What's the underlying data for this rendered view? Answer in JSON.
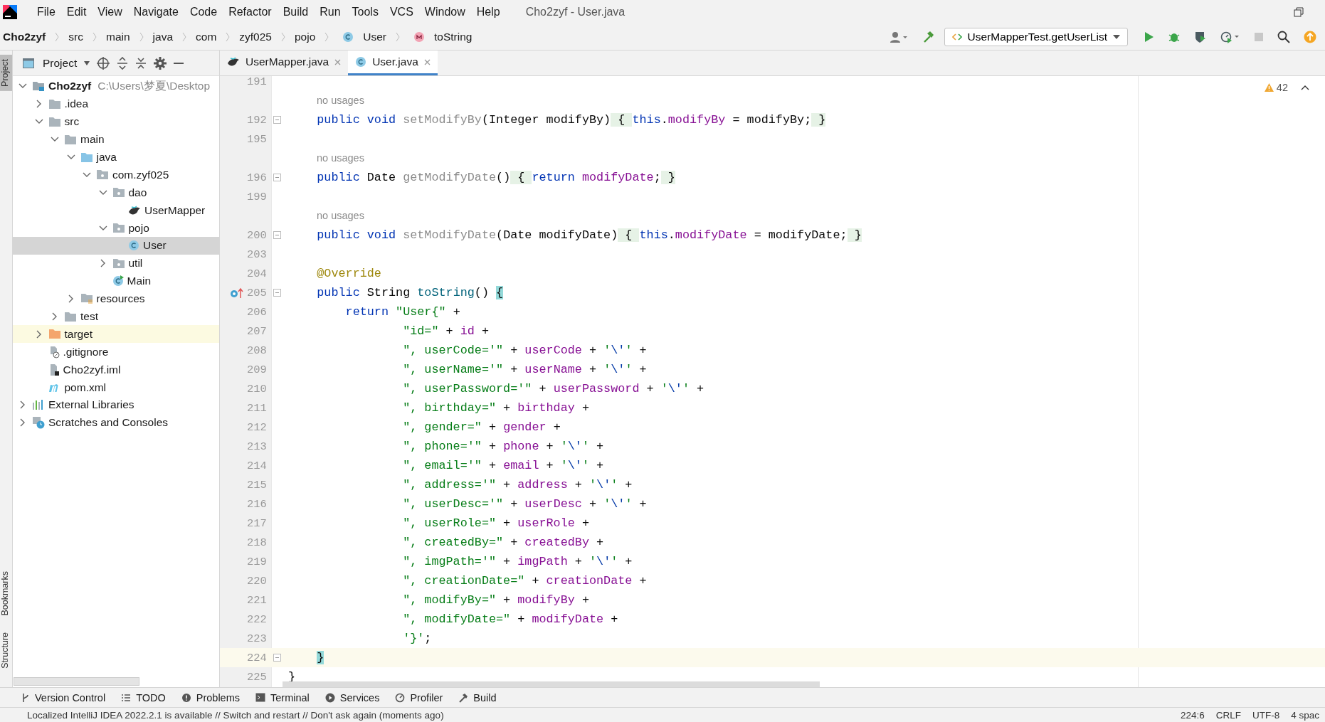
{
  "window": {
    "title": "Cho2zyf - User.java"
  },
  "menu": [
    "File",
    "Edit",
    "View",
    "Navigate",
    "Code",
    "Refactor",
    "Build",
    "Run",
    "Tools",
    "VCS",
    "Window",
    "Help"
  ],
  "breadcrumbs": [
    {
      "label": "Cho2zyf",
      "kind": "project"
    },
    {
      "label": "src",
      "kind": "folder"
    },
    {
      "label": "main",
      "kind": "folder"
    },
    {
      "label": "java",
      "kind": "folder"
    },
    {
      "label": "com",
      "kind": "folder"
    },
    {
      "label": "zyf025",
      "kind": "folder"
    },
    {
      "label": "pojo",
      "kind": "folder"
    },
    {
      "label": "User",
      "kind": "class"
    },
    {
      "label": "toString",
      "kind": "method"
    }
  ],
  "run_config": "UserMapperTest.getUserList",
  "side_strip": [
    {
      "label": "Project",
      "selected": true
    },
    {
      "label": "Bookmarks",
      "selected": false
    },
    {
      "label": "Structure",
      "selected": false
    }
  ],
  "project": {
    "title": "Project",
    "tree": [
      {
        "label": "Cho2zyf",
        "path": "C:\\Users\\梦夏\\Desktop",
        "kind": "module",
        "expanded": true,
        "selected": false,
        "highlighted": false,
        "children": [
          {
            "label": ".idea",
            "kind": "folder",
            "expanded": false,
            "selected": false,
            "highlighted": false
          },
          {
            "label": "src",
            "kind": "folder",
            "expanded": true,
            "selected": false,
            "highlighted": false,
            "children": [
              {
                "label": "main",
                "kind": "folder",
                "expanded": true,
                "selected": false,
                "highlighted": false,
                "children": [
                  {
                    "label": "java",
                    "kind": "source",
                    "expanded": true,
                    "selected": false,
                    "highlighted": false,
                    "children": [
                      {
                        "label": "com.zyf025",
                        "kind": "package",
                        "expanded": true,
                        "selected": false,
                        "highlighted": false,
                        "children": [
                          {
                            "label": "dao",
                            "kind": "package",
                            "expanded": true,
                            "selected": false,
                            "highlighted": false,
                            "children": [
                              {
                                "label": "UserMapper",
                                "kind": "mapper",
                                "selected": false,
                                "highlighted": false
                              }
                            ]
                          },
                          {
                            "label": "pojo",
                            "kind": "package",
                            "expanded": true,
                            "selected": false,
                            "highlighted": false,
                            "children": [
                              {
                                "label": "User",
                                "kind": "class",
                                "selected": true,
                                "highlighted": false
                              }
                            ]
                          },
                          {
                            "label": "util",
                            "kind": "package",
                            "expanded": false,
                            "selected": false,
                            "highlighted": false
                          },
                          {
                            "label": "Main",
                            "kind": "main",
                            "selected": false,
                            "highlighted": false
                          }
                        ]
                      }
                    ]
                  },
                  {
                    "label": "resources",
                    "kind": "resources",
                    "expanded": false,
                    "selected": false,
                    "highlighted": false
                  }
                ]
              },
              {
                "label": "test",
                "kind": "folder",
                "expanded": false,
                "selected": false,
                "highlighted": false
              }
            ]
          },
          {
            "label": "target",
            "kind": "excluded",
            "expanded": false,
            "selected": false,
            "highlighted": true
          },
          {
            "label": ".gitignore",
            "kind": "ignore",
            "selected": false,
            "highlighted": false
          },
          {
            "label": "Cho2zyf.iml",
            "kind": "iml",
            "selected": false,
            "highlighted": false
          },
          {
            "label": "pom.xml",
            "kind": "maven",
            "selected": false,
            "highlighted": false
          }
        ]
      },
      {
        "label": "External Libraries",
        "kind": "libraries",
        "expanded": false,
        "selected": false,
        "highlighted": false
      },
      {
        "label": "Scratches and Consoles",
        "kind": "scratches",
        "expanded": false,
        "selected": false,
        "highlighted": false
      }
    ]
  },
  "tabs": [
    {
      "label": "UserMapper.java",
      "kind": "mapper",
      "selected": false
    },
    {
      "label": "User.java",
      "kind": "class",
      "selected": true
    }
  ],
  "editor": {
    "warnings": "42",
    "rows": [
      {
        "kind": "code",
        "number": "191"
      },
      {
        "kind": "hint",
        "text": "no usages"
      },
      {
        "kind": "code",
        "number": "192",
        "fold_marker": true,
        "tokens": [
          {
            "text": "    public void ",
            "kind": "kw"
          },
          {
            "text": "setModifyBy",
            "kind": "unused"
          },
          {
            "text": "(Integer modifyBy)",
            "kind": "plain"
          },
          {
            "text": " { ",
            "kind": "fold"
          },
          {
            "text": "this",
            "kind": "kw"
          },
          {
            "text": ".",
            "kind": "plain"
          },
          {
            "text": "modifyBy",
            "kind": "field"
          },
          {
            "text": " = modifyBy;",
            "kind": "plain"
          },
          {
            "text": " }",
            "kind": "fold"
          }
        ]
      },
      {
        "kind": "code",
        "number": "195"
      },
      {
        "kind": "hint",
        "text": "no usages"
      },
      {
        "kind": "code",
        "number": "196",
        "fold_marker": true,
        "tokens": [
          {
            "text": "    public ",
            "kind": "kw"
          },
          {
            "text": "Date ",
            "kind": "plain"
          },
          {
            "text": "getModifyDate",
            "kind": "unused"
          },
          {
            "text": "()",
            "kind": "plain"
          },
          {
            "text": " { ",
            "kind": "fold"
          },
          {
            "text": "return ",
            "kind": "kw"
          },
          {
            "text": "modifyDate",
            "kind": "field"
          },
          {
            "text": ";",
            "kind": "plain"
          },
          {
            "text": " }",
            "kind": "fold"
          }
        ]
      },
      {
        "kind": "code",
        "number": "199"
      },
      {
        "kind": "hint",
        "text": "no usages"
      },
      {
        "kind": "code",
        "number": "200",
        "fold_marker": true,
        "tokens": [
          {
            "text": "    public void ",
            "kind": "kw"
          },
          {
            "text": "setModifyDate",
            "kind": "unused"
          },
          {
            "text": "(Date modifyDate)",
            "kind": "plain"
          },
          {
            "text": " { ",
            "kind": "fold"
          },
          {
            "text": "this",
            "kind": "kw"
          },
          {
            "text": ".",
            "kind": "plain"
          },
          {
            "text": "modifyDate",
            "kind": "field"
          },
          {
            "text": " = modifyDate;",
            "kind": "plain"
          },
          {
            "text": " }",
            "kind": "fold"
          }
        ]
      },
      {
        "kind": "code",
        "number": "203"
      },
      {
        "kind": "code",
        "number": "204",
        "tokens": [
          {
            "text": "    @Override",
            "kind": "ann"
          }
        ]
      },
      {
        "kind": "code",
        "number": "205",
        "fold_marker": true,
        "override_marker": true,
        "tokens": [
          {
            "text": "    public ",
            "kind": "kw"
          },
          {
            "text": "String ",
            "kind": "plain"
          },
          {
            "text": "toString",
            "kind": "call"
          },
          {
            "text": "() ",
            "kind": "plain"
          },
          {
            "text": "{",
            "kind": "match"
          }
        ]
      },
      {
        "kind": "code",
        "number": "206",
        "tokens": [
          {
            "text": "        return ",
            "kind": "kw"
          },
          {
            "text": "\"User{\"",
            "kind": "str"
          },
          {
            "text": " +",
            "kind": "plain"
          }
        ]
      },
      {
        "kind": "code",
        "number": "207",
        "tokens": [
          {
            "text": "                \"id=\"",
            "kind": "str"
          },
          {
            "text": " + ",
            "kind": "plain"
          },
          {
            "text": "id",
            "kind": "field"
          },
          {
            "text": " +",
            "kind": "plain"
          }
        ]
      },
      {
        "kind": "code",
        "number": "208",
        "tokens": [
          {
            "text": "                \", userCode='\"",
            "kind": "str"
          },
          {
            "text": " + ",
            "kind": "plain"
          },
          {
            "text": "userCode",
            "kind": "field"
          },
          {
            "text": " + ",
            "kind": "plain"
          },
          {
            "text": "'",
            "kind": "str"
          },
          {
            "text": "\\'",
            "kind": "esc"
          },
          {
            "text": "'",
            "kind": "str"
          },
          {
            "text": " +",
            "kind": "plain"
          }
        ]
      },
      {
        "kind": "code",
        "number": "209",
        "tokens": [
          {
            "text": "                \", userName='\"",
            "kind": "str"
          },
          {
            "text": " + ",
            "kind": "plain"
          },
          {
            "text": "userName",
            "kind": "field"
          },
          {
            "text": " + ",
            "kind": "plain"
          },
          {
            "text": "'",
            "kind": "str"
          },
          {
            "text": "\\'",
            "kind": "esc"
          },
          {
            "text": "'",
            "kind": "str"
          },
          {
            "text": " +",
            "kind": "plain"
          }
        ]
      },
      {
        "kind": "code",
        "number": "210",
        "tokens": [
          {
            "text": "                \", userPassword='\"",
            "kind": "str"
          },
          {
            "text": " + ",
            "kind": "plain"
          },
          {
            "text": "userPassword",
            "kind": "field"
          },
          {
            "text": " + ",
            "kind": "plain"
          },
          {
            "text": "'",
            "kind": "str"
          },
          {
            "text": "\\'",
            "kind": "esc"
          },
          {
            "text": "'",
            "kind": "str"
          },
          {
            "text": " +",
            "kind": "plain"
          }
        ]
      },
      {
        "kind": "code",
        "number": "211",
        "tokens": [
          {
            "text": "                \", birthday=\"",
            "kind": "str"
          },
          {
            "text": " + ",
            "kind": "plain"
          },
          {
            "text": "birthday",
            "kind": "field"
          },
          {
            "text": " +",
            "kind": "plain"
          }
        ]
      },
      {
        "kind": "code",
        "number": "212",
        "tokens": [
          {
            "text": "                \", gender=\"",
            "kind": "str"
          },
          {
            "text": " + ",
            "kind": "plain"
          },
          {
            "text": "gender",
            "kind": "field"
          },
          {
            "text": " +",
            "kind": "plain"
          }
        ]
      },
      {
        "kind": "code",
        "number": "213",
        "tokens": [
          {
            "text": "                \", phone='\"",
            "kind": "str"
          },
          {
            "text": " + ",
            "kind": "plain"
          },
          {
            "text": "phone",
            "kind": "field"
          },
          {
            "text": " + ",
            "kind": "plain"
          },
          {
            "text": "'",
            "kind": "str"
          },
          {
            "text": "\\'",
            "kind": "esc"
          },
          {
            "text": "'",
            "kind": "str"
          },
          {
            "text": " +",
            "kind": "plain"
          }
        ]
      },
      {
        "kind": "code",
        "number": "214",
        "tokens": [
          {
            "text": "                \", email='\"",
            "kind": "str"
          },
          {
            "text": " + ",
            "kind": "plain"
          },
          {
            "text": "email",
            "kind": "field"
          },
          {
            "text": " + ",
            "kind": "plain"
          },
          {
            "text": "'",
            "kind": "str"
          },
          {
            "text": "\\'",
            "kind": "esc"
          },
          {
            "text": "'",
            "kind": "str"
          },
          {
            "text": " +",
            "kind": "plain"
          }
        ]
      },
      {
        "kind": "code",
        "number": "215",
        "tokens": [
          {
            "text": "                \", address='\"",
            "kind": "str"
          },
          {
            "text": " + ",
            "kind": "plain"
          },
          {
            "text": "address",
            "kind": "field"
          },
          {
            "text": " + ",
            "kind": "plain"
          },
          {
            "text": "'",
            "kind": "str"
          },
          {
            "text": "\\'",
            "kind": "esc"
          },
          {
            "text": "'",
            "kind": "str"
          },
          {
            "text": " +",
            "kind": "plain"
          }
        ]
      },
      {
        "kind": "code",
        "number": "216",
        "tokens": [
          {
            "text": "                \", userDesc='\"",
            "kind": "str"
          },
          {
            "text": " + ",
            "kind": "plain"
          },
          {
            "text": "userDesc",
            "kind": "field"
          },
          {
            "text": " + ",
            "kind": "plain"
          },
          {
            "text": "'",
            "kind": "str"
          },
          {
            "text": "\\'",
            "kind": "esc"
          },
          {
            "text": "'",
            "kind": "str"
          },
          {
            "text": " +",
            "kind": "plain"
          }
        ]
      },
      {
        "kind": "code",
        "number": "217",
        "tokens": [
          {
            "text": "                \", userRole=\"",
            "kind": "str"
          },
          {
            "text": " + ",
            "kind": "plain"
          },
          {
            "text": "userRole",
            "kind": "field"
          },
          {
            "text": " +",
            "kind": "plain"
          }
        ]
      },
      {
        "kind": "code",
        "number": "218",
        "tokens": [
          {
            "text": "                \", createdBy=\"",
            "kind": "str"
          },
          {
            "text": " + ",
            "kind": "plain"
          },
          {
            "text": "createdBy",
            "kind": "field"
          },
          {
            "text": " +",
            "kind": "plain"
          }
        ]
      },
      {
        "kind": "code",
        "number": "219",
        "tokens": [
          {
            "text": "                \", imgPath='\"",
            "kind": "str"
          },
          {
            "text": " + ",
            "kind": "plain"
          },
          {
            "text": "imgPath",
            "kind": "field"
          },
          {
            "text": " + ",
            "kind": "plain"
          },
          {
            "text": "'",
            "kind": "str"
          },
          {
            "text": "\\'",
            "kind": "esc"
          },
          {
            "text": "'",
            "kind": "str"
          },
          {
            "text": " +",
            "kind": "plain"
          }
        ]
      },
      {
        "kind": "code",
        "number": "220",
        "tokens": [
          {
            "text": "                \", creationDate=\"",
            "kind": "str"
          },
          {
            "text": " + ",
            "kind": "plain"
          },
          {
            "text": "creationDate",
            "kind": "field"
          },
          {
            "text": " +",
            "kind": "plain"
          }
        ]
      },
      {
        "kind": "code",
        "number": "221",
        "tokens": [
          {
            "text": "                \", modifyBy=\"",
            "kind": "str"
          },
          {
            "text": " + ",
            "kind": "plain"
          },
          {
            "text": "modifyBy",
            "kind": "field"
          },
          {
            "text": " +",
            "kind": "plain"
          }
        ]
      },
      {
        "kind": "code",
        "number": "222",
        "tokens": [
          {
            "text": "                \", modifyDate=\"",
            "kind": "str"
          },
          {
            "text": " + ",
            "kind": "plain"
          },
          {
            "text": "modifyDate",
            "kind": "field"
          },
          {
            "text": " +",
            "kind": "plain"
          }
        ]
      },
      {
        "kind": "code",
        "number": "223",
        "tokens": [
          {
            "text": "                '}'",
            "kind": "str"
          },
          {
            "text": ";",
            "kind": "plain"
          }
        ]
      },
      {
        "kind": "code",
        "number": "224",
        "current": true,
        "fold_marker": true,
        "tokens": [
          {
            "text": "    }",
            "kind": "match"
          }
        ]
      },
      {
        "kind": "code",
        "number": "225",
        "tokens": [
          {
            "text": "}",
            "kind": "plain"
          }
        ]
      }
    ]
  },
  "tool_windows": [
    {
      "label": "Version Control",
      "kind": "vcs"
    },
    {
      "label": "TODO",
      "kind": "todo"
    },
    {
      "label": "Problems",
      "kind": "problems"
    },
    {
      "label": "Terminal",
      "kind": "terminal"
    },
    {
      "label": "Services",
      "kind": "services"
    },
    {
      "label": "Profiler",
      "kind": "profiler"
    },
    {
      "label": "Build",
      "kind": "build"
    }
  ],
  "status_bar": {
    "message": "Localized IntelliJ IDEA 2022.2.1 is available // Switch and restart // Don't ask again (moments ago)",
    "position": "224:6",
    "line_separator": "CRLF",
    "encoding": "UTF-8",
    "indent": "4 spac"
  }
}
